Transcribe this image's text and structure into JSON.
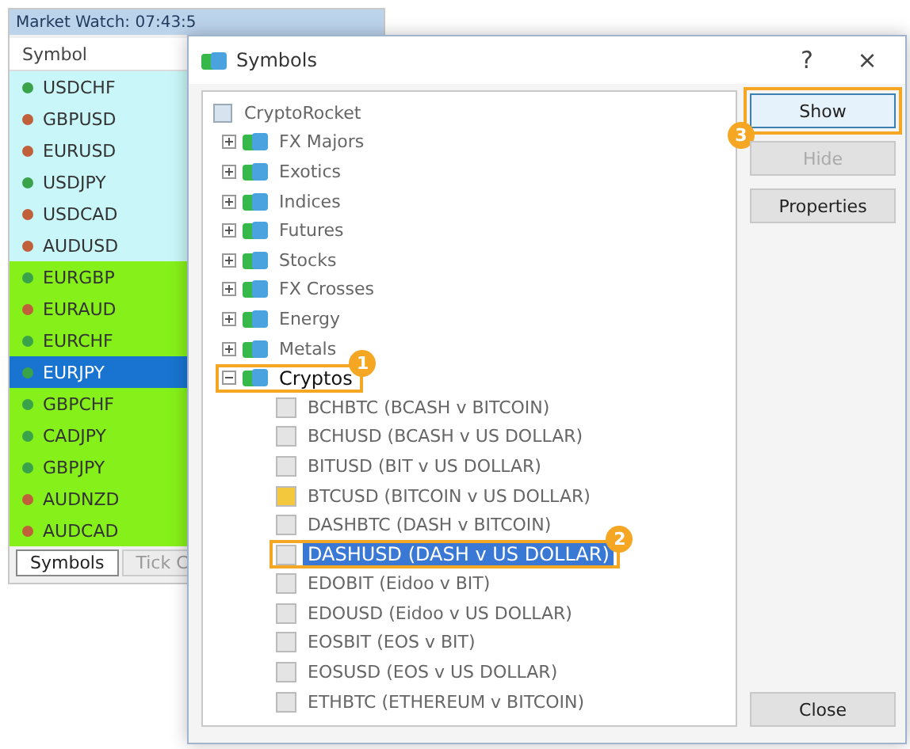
{
  "market_watch": {
    "title": "Market Watch: 07:43:5",
    "column": "Symbol",
    "rows": [
      {
        "symbol": "USDCHF",
        "kind": "major",
        "color": "#3aa34a",
        "selected": false
      },
      {
        "symbol": "GBPUSD",
        "kind": "major",
        "color": "#c0603a",
        "selected": false
      },
      {
        "symbol": "EURUSD",
        "kind": "major",
        "color": "#c0603a",
        "selected": false
      },
      {
        "symbol": "USDJPY",
        "kind": "major",
        "color": "#3aa34a",
        "selected": false
      },
      {
        "symbol": "USDCAD",
        "kind": "major",
        "color": "#c0603a",
        "selected": false
      },
      {
        "symbol": "AUDUSD",
        "kind": "major",
        "color": "#c0603a",
        "selected": false
      },
      {
        "symbol": "EURGBP",
        "kind": "cross",
        "color": "#3aa34a",
        "selected": false
      },
      {
        "symbol": "EURAUD",
        "kind": "cross",
        "color": "#c0603a",
        "selected": false
      },
      {
        "symbol": "EURCHF",
        "kind": "cross",
        "color": "#3aa34a",
        "selected": false
      },
      {
        "symbol": "EURJPY",
        "color": "#3aa34a",
        "selected": true
      },
      {
        "symbol": "GBPCHF",
        "kind": "cross",
        "color": "#3aa34a",
        "selected": false
      },
      {
        "symbol": "CADJPY",
        "kind": "cross",
        "color": "#3aa34a",
        "selected": false
      },
      {
        "symbol": "GBPJPY",
        "kind": "cross",
        "color": "#3aa34a",
        "selected": false
      },
      {
        "symbol": "AUDNZD",
        "kind": "cross",
        "color": "#c0603a",
        "selected": false
      },
      {
        "symbol": "AUDCAD",
        "kind": "cross",
        "color": "#c0603a",
        "selected": false
      }
    ],
    "tabs": [
      {
        "label": "Symbols",
        "selected": true
      },
      {
        "label": "Tick C",
        "selected": false
      }
    ]
  },
  "dialog": {
    "title": "Symbols",
    "help": "?",
    "close": "×",
    "tree": {
      "label": "CryptoRocket",
      "children": [
        {
          "label": "FX Majors",
          "expanded": false
        },
        {
          "label": "Exotics",
          "expanded": false
        },
        {
          "label": "Indices",
          "expanded": false
        },
        {
          "label": "Futures",
          "expanded": false
        },
        {
          "label": "Stocks",
          "expanded": false
        },
        {
          "label": "FX Crosses",
          "expanded": false
        },
        {
          "label": "Energy",
          "expanded": false
        },
        {
          "label": "Metals",
          "expanded": false
        },
        {
          "label": "Cryptos",
          "expanded": true,
          "callout": "1",
          "children": [
            {
              "label": "BCHBTC  (BCASH v BITCOIN)",
              "shown": false,
              "selected": false
            },
            {
              "label": "BCHUSD  (BCASH v US DOLLAR)",
              "shown": false,
              "selected": false
            },
            {
              "label": "BITUSD  (BIT v US DOLLAR)",
              "shown": false,
              "selected": false
            },
            {
              "label": "BTCUSD  (BITCOIN v US DOLLAR)",
              "shown": true,
              "selected": false
            },
            {
              "label": "DASHBTC  (DASH v BITCOIN)",
              "shown": false,
              "selected": false
            },
            {
              "label": "DASHUSD  (DASH v US DOLLAR)",
              "shown": false,
              "selected": true,
              "callout": "2"
            },
            {
              "label": "EDOBIT  (Eidoo v BIT)",
              "shown": false,
              "selected": false
            },
            {
              "label": "EDOUSD  (Eidoo v US DOLLAR)",
              "shown": false,
              "selected": false
            },
            {
              "label": "EOSBIT  (EOS v BIT)",
              "shown": false,
              "selected": false
            },
            {
              "label": "EOSUSD  (EOS v US DOLLAR)",
              "shown": false,
              "selected": false
            },
            {
              "label": "ETHBTC  (ETHEREUM v BITCOIN)",
              "shown": false,
              "selected": false
            }
          ]
        }
      ]
    },
    "buttons": [
      {
        "label": "Show",
        "disabled": false,
        "callout": "3"
      },
      {
        "label": "Hide",
        "disabled": true
      },
      {
        "label": "Properties",
        "disabled": false
      }
    ],
    "close_button": "Close"
  }
}
